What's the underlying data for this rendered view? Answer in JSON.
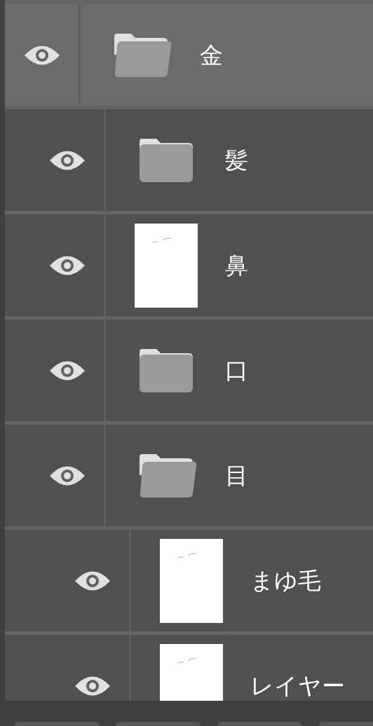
{
  "layers": [
    {
      "name": "金",
      "kind": "folder",
      "expanded": true,
      "visible": true,
      "selected": true,
      "children": [
        {
          "name": "髪",
          "kind": "folder",
          "expanded": false,
          "visible": true,
          "selected": false
        },
        {
          "name": "鼻",
          "kind": "layer",
          "visible": true,
          "selected": false
        },
        {
          "name": "口",
          "kind": "folder",
          "expanded": false,
          "visible": true,
          "selected": false
        },
        {
          "name": "目",
          "kind": "folder",
          "expanded": true,
          "visible": true,
          "selected": false,
          "children": [
            {
              "name": "まゆ毛",
              "kind": "layer",
              "visible": true,
              "selected": false
            },
            {
              "name": "レイヤー",
              "kind": "layer",
              "visible": true,
              "selected": false
            }
          ]
        }
      ]
    }
  ]
}
